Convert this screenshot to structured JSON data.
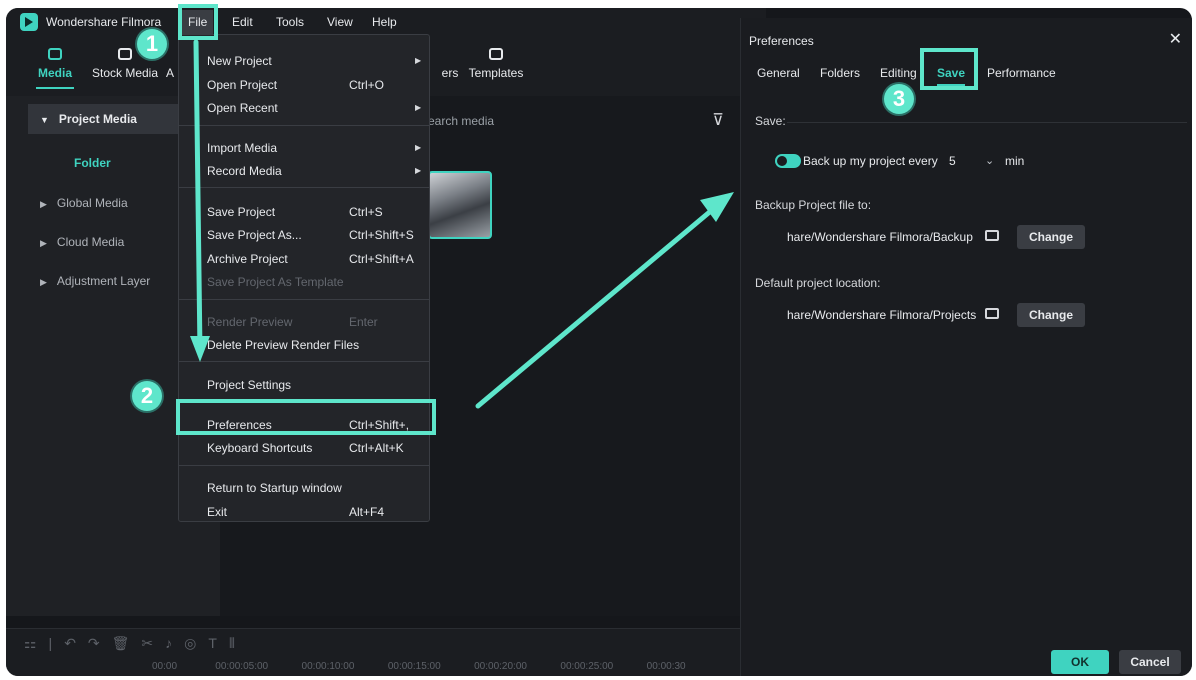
{
  "app": {
    "title": "Wondershare Filmora",
    "menubar": [
      "File",
      "Edit",
      "Tools",
      "View",
      "Help"
    ]
  },
  "library": {
    "tabs": [
      "Media",
      "Stock Media",
      "A",
      "ers",
      "Templates"
    ],
    "search_placeholder": "Search media"
  },
  "sidebar": {
    "project_media": "Project Media",
    "folder": "Folder",
    "items": [
      "Global Media",
      "Cloud Media",
      "Adjustment Layer"
    ]
  },
  "timeline": {
    "ruler": [
      "00:00",
      "00:00:05:00",
      "00:00:10:00",
      "00:00:15:00",
      "00:00:20:00",
      "00:00:25:00",
      "00:00:30"
    ]
  },
  "file_menu": {
    "items": [
      {
        "label": "New Project",
        "shortcut": "",
        "submenu": true,
        "disabled": false
      },
      {
        "label": "Open Project",
        "shortcut": "Ctrl+O",
        "submenu": false,
        "disabled": false
      },
      {
        "label": "Open Recent",
        "shortcut": "",
        "submenu": true,
        "disabled": false
      },
      {
        "label": "Import Media",
        "shortcut": "",
        "submenu": true,
        "disabled": false
      },
      {
        "label": "Record Media",
        "shortcut": "",
        "submenu": true,
        "disabled": false
      },
      {
        "label": "Save Project",
        "shortcut": "Ctrl+S",
        "submenu": false,
        "disabled": false
      },
      {
        "label": "Save Project As...",
        "shortcut": "Ctrl+Shift+S",
        "submenu": false,
        "disabled": false
      },
      {
        "label": "Archive Project",
        "shortcut": "Ctrl+Shift+A",
        "submenu": false,
        "disabled": false
      },
      {
        "label": "Save Project As Template",
        "shortcut": "",
        "submenu": false,
        "disabled": true
      },
      {
        "label": "Render Preview",
        "shortcut": "Enter",
        "submenu": false,
        "disabled": true
      },
      {
        "label": "Delete Preview Render Files",
        "shortcut": "",
        "submenu": false,
        "disabled": false
      },
      {
        "label": "Project Settings",
        "shortcut": "",
        "submenu": false,
        "disabled": false
      },
      {
        "label": "Preferences",
        "shortcut": "Ctrl+Shift+,",
        "submenu": false,
        "disabled": false
      },
      {
        "label": "Keyboard Shortcuts",
        "shortcut": "Ctrl+Alt+K",
        "submenu": false,
        "disabled": false
      },
      {
        "label": "Return to Startup window",
        "shortcut": "",
        "submenu": false,
        "disabled": false
      },
      {
        "label": "Exit",
        "shortcut": "Alt+F4",
        "submenu": false,
        "disabled": false
      }
    ]
  },
  "preferences": {
    "title": "Preferences",
    "tabs": [
      "General",
      "Folders",
      "Editing",
      "Save",
      "Performance"
    ],
    "active_tab": "Save",
    "save_label": "Save:",
    "backup_toggle_label": "Back up my project every",
    "backup_toggle_on": true,
    "backup_interval": "5",
    "backup_unit": "min",
    "backup_file_label": "Backup Project file to:",
    "backup_path": "hare/Wondershare Filmora/Backup",
    "default_location_label": "Default project location:",
    "default_path": "hare/Wondershare Filmora/Projects",
    "change_label": "Change",
    "ok_label": "OK",
    "cancel_label": "Cancel"
  },
  "annotations": {
    "steps": [
      "1",
      "2",
      "3"
    ],
    "accent": "#5ee6cb"
  }
}
